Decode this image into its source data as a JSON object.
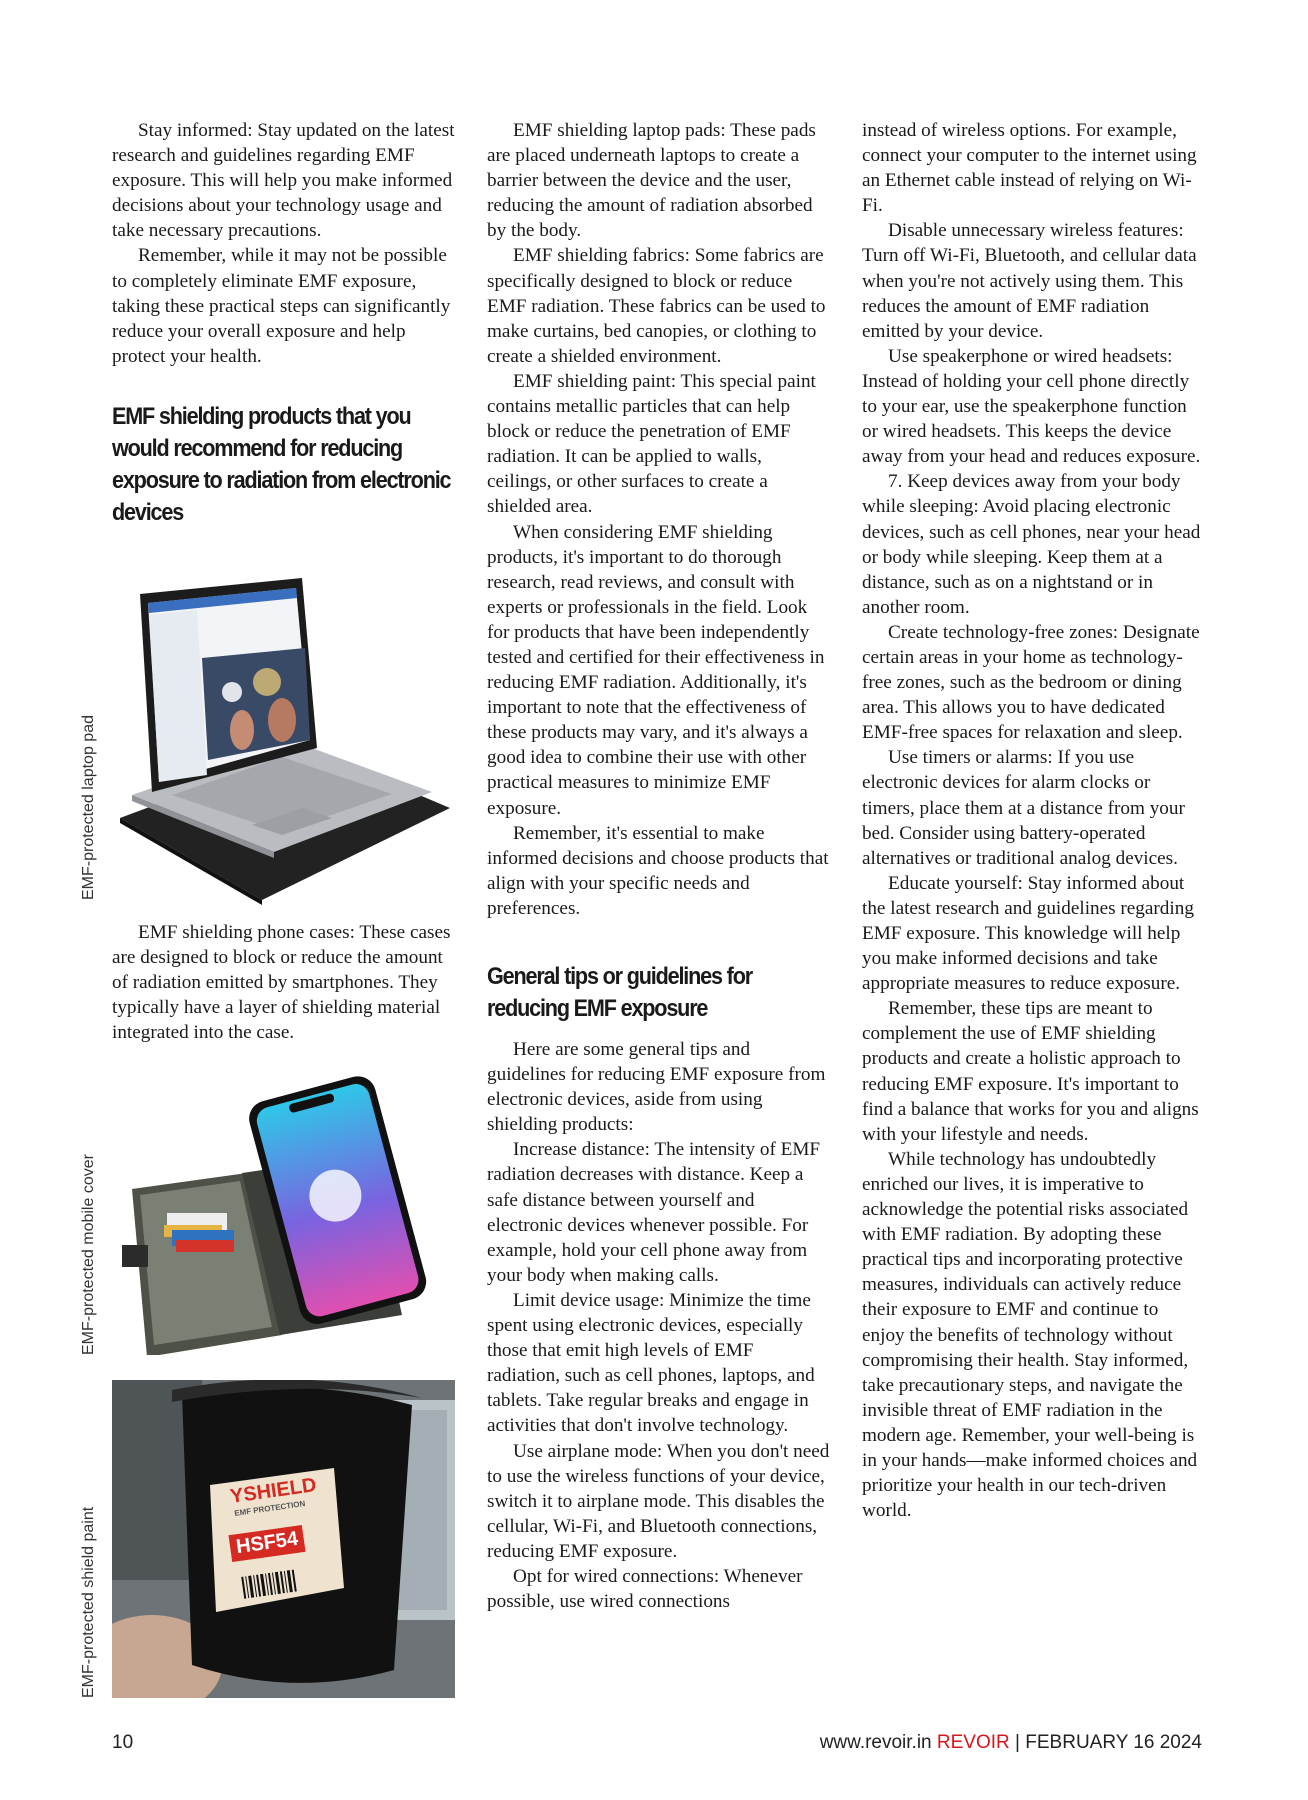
{
  "col1": {
    "p1": "Stay informed: Stay updated on the latest research and guidelines regarding EMF exposure. This will help you make informed decisions about your technology usage and take necessary precautions.",
    "p2": "Remember, while it may not be possible to completely eliminate EMF exposure, taking these practical steps can significantly reduce your overall exposure and help protect your health.",
    "heading": "EMF shielding products that you would recommend for reducing exposure to radiation from electronic devices",
    "p3": "EMF shielding phone cases: These cases are designed to block or reduce the amount of radiation emitted by smartphones. They typically have a layer of shielding material integrated into the case."
  },
  "captions": {
    "laptop": "EMF-protected laptop pad",
    "mobile": "EMF-protected mobile cover",
    "paint": "EMF-protected shield paint"
  },
  "paint_label": {
    "brand": "YSHIELD",
    "sub": "EMF PROTECTION",
    "code": "HSF54"
  },
  "col2": {
    "p1": "EMF shielding laptop pads: These pads are placed underneath laptops to create a barrier between the device and the user, reducing the amount of radiation absorbed by the body.",
    "p2": "EMF shielding fabrics: Some fabrics are specifically designed to block or reduce EMF radiation. These fabrics can be used to make curtains, bed canopies, or clothing to create a shielded environment.",
    "p3": "EMF shielding paint: This special paint contains metallic particles that can help block or reduce the penetration of EMF radiation. It can be applied to walls, ceilings, or other surfaces to create a shielded area.",
    "p4": "When considering EMF shielding products, it's important to do thorough research, read reviews, and consult with experts or professionals in the field. Look for products that have been independently tested and certified for their effectiveness in reducing EMF radiation. Additionally, it's important to note that the effectiveness of these products may vary, and it's always a good idea to combine their use with other practical measures to minimize EMF exposure.",
    "p5": "Remember, it's essential to make informed decisions and choose products that align with your specific needs and preferences.",
    "heading": "General tips or guidelines for reducing EMF exposure",
    "p6": "Here are some general tips and guidelines for reducing EMF exposure from electronic devices, aside from using shielding products:",
    "p7": "Increase distance: The intensity of EMF radiation decreases with distance. Keep a safe distance between yourself and electronic devices whenever possible. For example, hold your cell phone away from your body when making calls.",
    "p8": "Limit device usage: Minimize the time spent using electronic devices, especially those that emit high levels of EMF radiation, such as cell phones, laptops, and tablets. Take regular breaks and engage in activities that don't involve technology.",
    "p9": "Use airplane mode: When you don't need to use the wireless functions of your device, switch it to airplane mode. This disables the cellular, Wi-Fi, and Bluetooth connections, reducing EMF exposure.",
    "p10": "Opt for wired connections: Whenever possible, use wired connections"
  },
  "col3": {
    "p1": "instead of wireless options. For example, connect your computer to the internet using an Ethernet cable instead of relying on Wi-Fi.",
    "p2": "Disable unnecessary wireless features: Turn off Wi-Fi, Bluetooth, and cellular data when you're not actively using them. This reduces the amount of EMF radiation emitted by your device.",
    "p3": "Use speakerphone or wired headsets: Instead of holding your cell phone directly to your ear, use the speakerphone function or wired headsets. This keeps the device away from your head and reduces exposure.",
    "p4": "7. Keep devices away from your body while sleeping: Avoid placing electronic devices, such as cell phones, near your head or body while sleeping. Keep them at a distance, such as on a nightstand or in another room.",
    "p5": "Create technology-free zones: Designate certain areas in your home as technology-free zones, such as the bedroom or dining area. This allows you to have dedicated EMF-free spaces for relaxation and sleep.",
    "p6": "Use timers or alarms: If you use electronic devices for alarm clocks or timers, place them at a distance from your bed. Consider using battery-operated alternatives or traditional analog devices.",
    "p7": "Educate yourself: Stay informed about the latest research and guidelines regarding EMF exposure. This knowledge will help you make informed decisions and take appropriate measures to reduce exposure.",
    "p8": "Remember, these tips are meant to complement the use of EMF shielding products and create a holistic approach to reducing EMF exposure. It's important to find a balance that works for you and aligns with your lifestyle and needs.",
    "p9": "While technology has undoubtedly enriched our lives, it is imperative to acknowledge the potential risks associated with EMF radiation. By adopting these practical tips and incorporating protective measures, individuals can actively reduce their exposure to EMF and continue to enjoy the benefits of technology without compromising their health. Stay informed, take precautionary steps, and navigate the invisible threat of EMF radiation in the modern age. Remember, your well-being is in your hands—make informed choices and prioritize your health in our tech-driven world."
  },
  "footer": {
    "page_number": "10",
    "site": "www.revoir.in",
    "brand": "REVOIR",
    "separator": "|",
    "date": "FEBRUARY 16 2024"
  },
  "colors": {
    "accent": "#d6161d",
    "text": "#1a1a1a"
  }
}
